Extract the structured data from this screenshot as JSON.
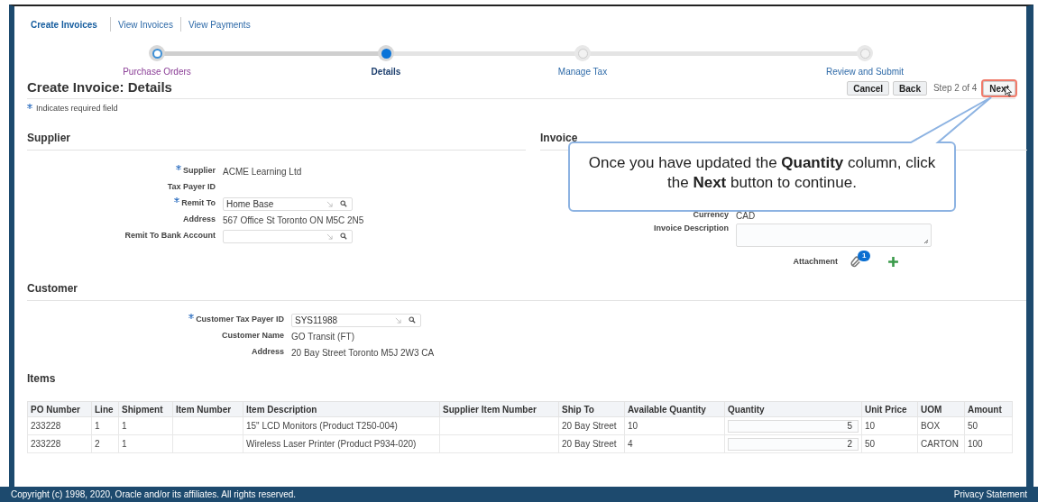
{
  "tabs": [
    {
      "label": "Create Invoices",
      "selected": true
    },
    {
      "label": "View Invoices",
      "selected": false
    },
    {
      "label": "View Payments",
      "selected": false
    }
  ],
  "train": [
    {
      "label": "Purchase Orders",
      "visited": true,
      "selected": false
    },
    {
      "label": "Details",
      "visited": false,
      "selected": true
    },
    {
      "label": "Manage Tax",
      "visited": false,
      "selected": false
    },
    {
      "label": "Review and Submit",
      "visited": false,
      "selected": false
    }
  ],
  "page_title": "Create Invoice: Details",
  "buttons": [
    {
      "label": "Cancel",
      "highlighted": false
    },
    {
      "label": "Back",
      "highlighted": false
    },
    {
      "kind": "step",
      "label": "Step 2 of 4"
    },
    {
      "label": "Next",
      "highlighted": true
    }
  ],
  "required_note": "Indicates required field",
  "supplier": {
    "title": "Supplier",
    "fields": [
      {
        "kind": "text",
        "label": "Supplier",
        "required": true,
        "value": "ACME Learning Ltd"
      },
      {
        "kind": "text",
        "label": "Tax Payer ID",
        "required": false
      },
      {
        "kind": "lov",
        "label": "Remit To",
        "required": true,
        "value": "Home Base"
      },
      {
        "kind": "text",
        "label": "Address",
        "required": false,
        "value": "567 Office St Toronto ON M5C 2N5"
      },
      {
        "kind": "lov",
        "label": "Remit To Bank Account",
        "required": false
      }
    ]
  },
  "invoice": {
    "title": "Invoice",
    "fields": [
      {
        "kind": "text",
        "label": "Currency",
        "value": "CAD"
      },
      {
        "kind": "textarea",
        "label": "Invoice Description"
      },
      {
        "kind": "attachment",
        "label": "Attachment",
        "count": "1"
      }
    ]
  },
  "customer": {
    "title": "Customer",
    "fields": [
      {
        "kind": "lov",
        "label": "Customer Tax Payer ID",
        "required": true,
        "value": "SYS11988"
      },
      {
        "kind": "text",
        "label": "Customer Name",
        "required": false,
        "value": "GO Transit (FT)"
      },
      {
        "kind": "text",
        "label": "Address",
        "required": false,
        "value": "20 Bay Street Toronto M5J 2W3 CA"
      }
    ]
  },
  "items": {
    "title": "Items",
    "columns": [
      "PO Number",
      "Line",
      "Shipment",
      "Item Number",
      "Item Description",
      "Supplier Item Number",
      "Ship To",
      "Available Quantity",
      "Quantity",
      "Unit Price",
      "UOM",
      "Amount"
    ],
    "rows": [
      [
        "233228",
        "1",
        "1",
        "",
        "15\" LCD Monitors (Product T250-004)",
        "",
        "20 Bay Street",
        "10",
        "5",
        "10",
        "BOX",
        "50"
      ],
      [
        "233228",
        "2",
        "1",
        "",
        "Wireless Laser Printer (Product P934-020)",
        "",
        "20 Bay Street",
        "4",
        "2",
        "50",
        "CARTON",
        "100"
      ]
    ]
  },
  "callout": "Once you have updated the **Quantity** column, click the **Next** button to continue.",
  "footer": {
    "copyright": "Copyright (c) 1998, 2020, Oracle and/or its affiliates. All rights reserved.",
    "link": "Privacy Statement"
  }
}
